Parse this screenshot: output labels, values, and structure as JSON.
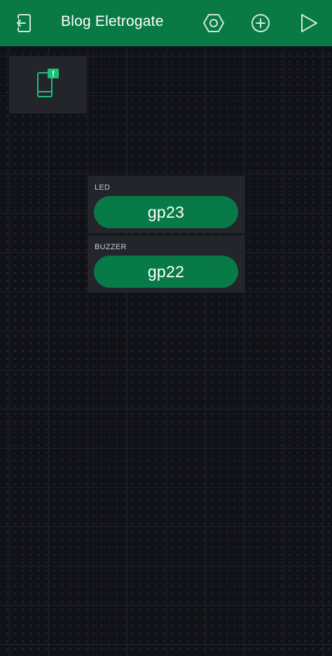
{
  "header": {
    "title": "Blog Eletrogate",
    "icons": {
      "back": "exit-project-icon",
      "settings": "hexagon-settings-icon",
      "add": "plus-circle-icon",
      "play": "play-icon"
    }
  },
  "canvas": {
    "device_icon": "device-notification-icon",
    "widgets": [
      {
        "label": "LED",
        "button_text": "gp23"
      },
      {
        "label": "BUZZER",
        "button_text": "gp22"
      }
    ]
  },
  "colors": {
    "header_bg": "#0a7a45",
    "canvas_bg": "#111217",
    "widget_bg": "#23252b",
    "button_bg": "#087a47",
    "accent": "#1fbf78"
  }
}
